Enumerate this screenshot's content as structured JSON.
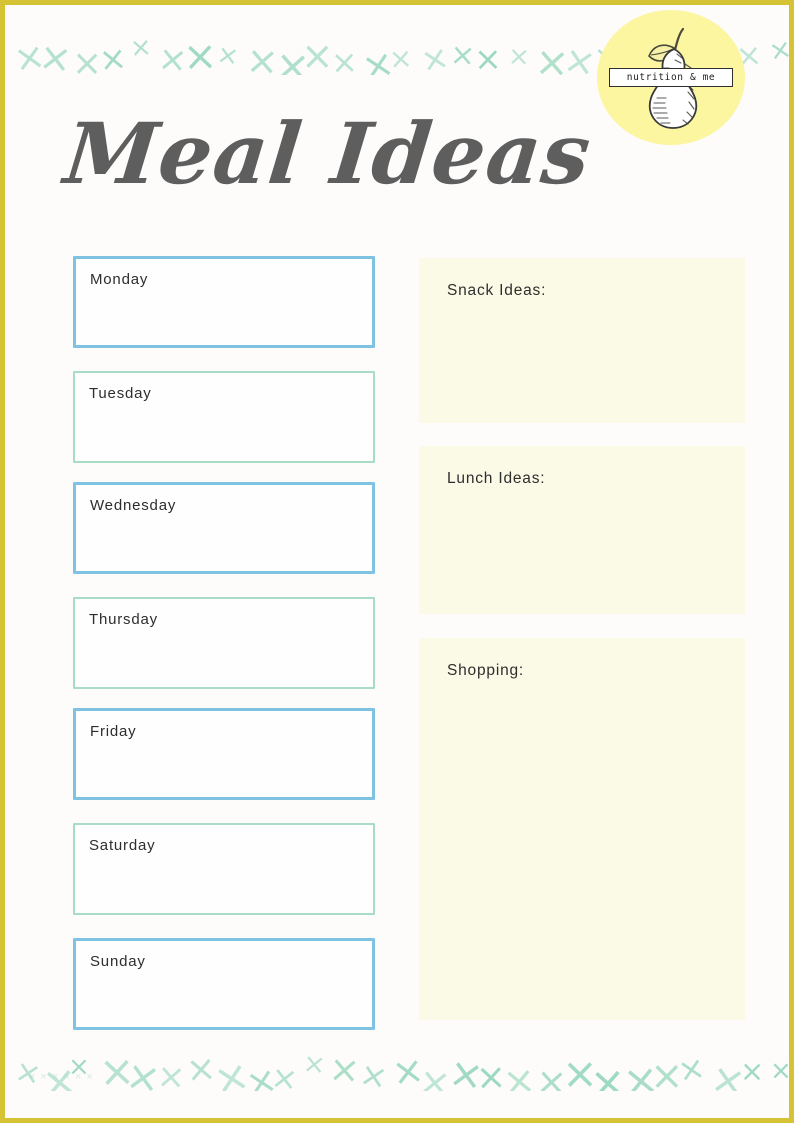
{
  "page": {
    "title": "Meal Ideas",
    "background_color": "#fdfcfb",
    "frame_color": "#d6c235",
    "title_color": "#5e5e5e"
  },
  "decoration": {
    "x_mark_glyph": "×",
    "x_mark_color": "#9dd9c2",
    "top_band_count": 27,
    "bottom_band_count": 27
  },
  "logo": {
    "tagline": "nutrition & me",
    "disc_color": "#fbf69f",
    "fruit": "pear"
  },
  "days": [
    {
      "label": "Monday",
      "accent": "blue",
      "color": "#7fc3e3"
    },
    {
      "label": "Tuesday",
      "accent": "mint",
      "color": "#a8dcc6"
    },
    {
      "label": "Wednesday",
      "accent": "blue",
      "color": "#7fc3e3"
    },
    {
      "label": "Thursday",
      "accent": "mint",
      "color": "#a8dcc6"
    },
    {
      "label": "Friday",
      "accent": "blue",
      "color": "#7fc3e3"
    },
    {
      "label": "Saturday",
      "accent": "mint",
      "color": "#a8dcc6"
    },
    {
      "label": "Sunday",
      "accent": "blue",
      "color": "#7fc3e3"
    }
  ],
  "panels": [
    {
      "label": "Snack Ideas:",
      "fill": "#fafae6"
    },
    {
      "label": "Lunch Ideas:",
      "fill": "#fafae6"
    },
    {
      "label": "Shopping:",
      "fill": "#fafae6"
    }
  ],
  "watermark": {
    "text": "× × × × × ×"
  }
}
